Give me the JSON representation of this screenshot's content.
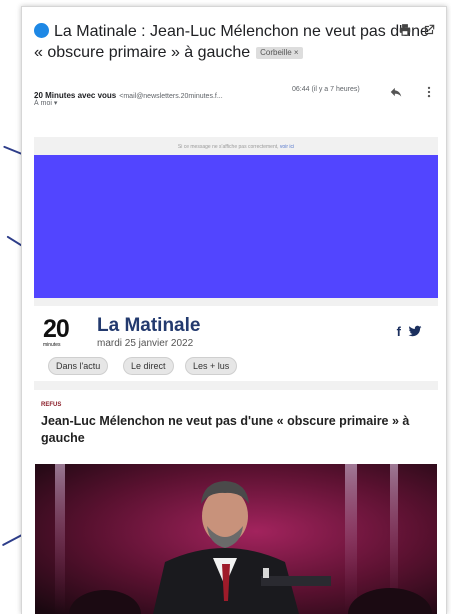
{
  "email": {
    "subject": "La Matinale : Jean-Luc Mélenchon ne veut pas d'une « obscure primaire » à gauche",
    "folder_chip": "Corbeille ×",
    "sender_name": "20 Minutes avec vous",
    "sender_email": "<mail@newsletters.20minutes.f...",
    "time": "06:44 (il y a 7 heures)",
    "recipient": "À moi ▾",
    "icons": [
      "print-icon",
      "open-external-icon",
      "reply-icon",
      "more-vert-icon"
    ]
  },
  "newsletter": {
    "notice": "Si ce message ne s'affiche pas correctement, ",
    "notice_link": "voir ici",
    "logo_number": "20",
    "logo_sub": "minutes",
    "title": "La Matinale",
    "date": "mardi 25 janvier 2022",
    "social": [
      "facebook-icon",
      "twitter-icon"
    ],
    "tabs": [
      "Dans l'actu",
      "Le direct",
      "Les + lus"
    ],
    "kicker": "REFUS",
    "headline": "Jean-Luc Mélenchon ne veut pas d'une « obscure primaire » à gauche"
  },
  "colors": {
    "blue_block": "#5245ff",
    "title_navy": "#233a6e",
    "unread_dot": "#1e88e5",
    "kicker_red": "#8a1d28"
  }
}
